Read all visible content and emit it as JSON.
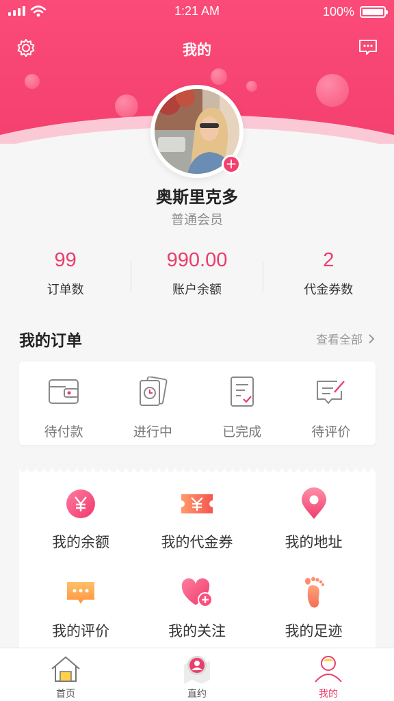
{
  "status_bar": {
    "time": "1:21 AM",
    "battery": "100%"
  },
  "nav": {
    "title": "我的",
    "settings_icon": "gear-icon",
    "message_icon": "chat-bubble-icon"
  },
  "profile": {
    "name": "奥斯里克多",
    "level": "普通会员",
    "add_badge": "+"
  },
  "stats": [
    {
      "value": "99",
      "label": "订单数"
    },
    {
      "value": "990.00",
      "label": "账户余额"
    },
    {
      "value": "2",
      "label": "代金券数"
    }
  ],
  "orders": {
    "title": "我的订单",
    "view_all": "查看全部",
    "items": [
      {
        "label": "待付款",
        "icon": "wallet-icon"
      },
      {
        "label": "进行中",
        "icon": "clock-cards-icon"
      },
      {
        "label": "已完成",
        "icon": "checked-document-icon"
      },
      {
        "label": "待评价",
        "icon": "edit-comment-icon"
      }
    ]
  },
  "services": [
    {
      "label": "我的余额",
      "icon": "yen-coin-icon"
    },
    {
      "label": "我的代金券",
      "icon": "yen-coupon-icon"
    },
    {
      "label": "我的地址",
      "icon": "location-pin-icon"
    },
    {
      "label": "我的评价",
      "icon": "comment-icon"
    },
    {
      "label": "我的关注",
      "icon": "heart-plus-icon"
    },
    {
      "label": "我的足迹",
      "icon": "footprint-icon"
    }
  ],
  "tabbar": [
    {
      "label": "首页",
      "icon": "home-icon"
    },
    {
      "label": "直约",
      "icon": "map-pin-avatar-icon"
    },
    {
      "label": "我的",
      "icon": "user-icon",
      "active": true
    }
  ],
  "colors": {
    "brand": "#f4406f",
    "accent": "#ea3d6b",
    "background": "#f6f6f6"
  }
}
